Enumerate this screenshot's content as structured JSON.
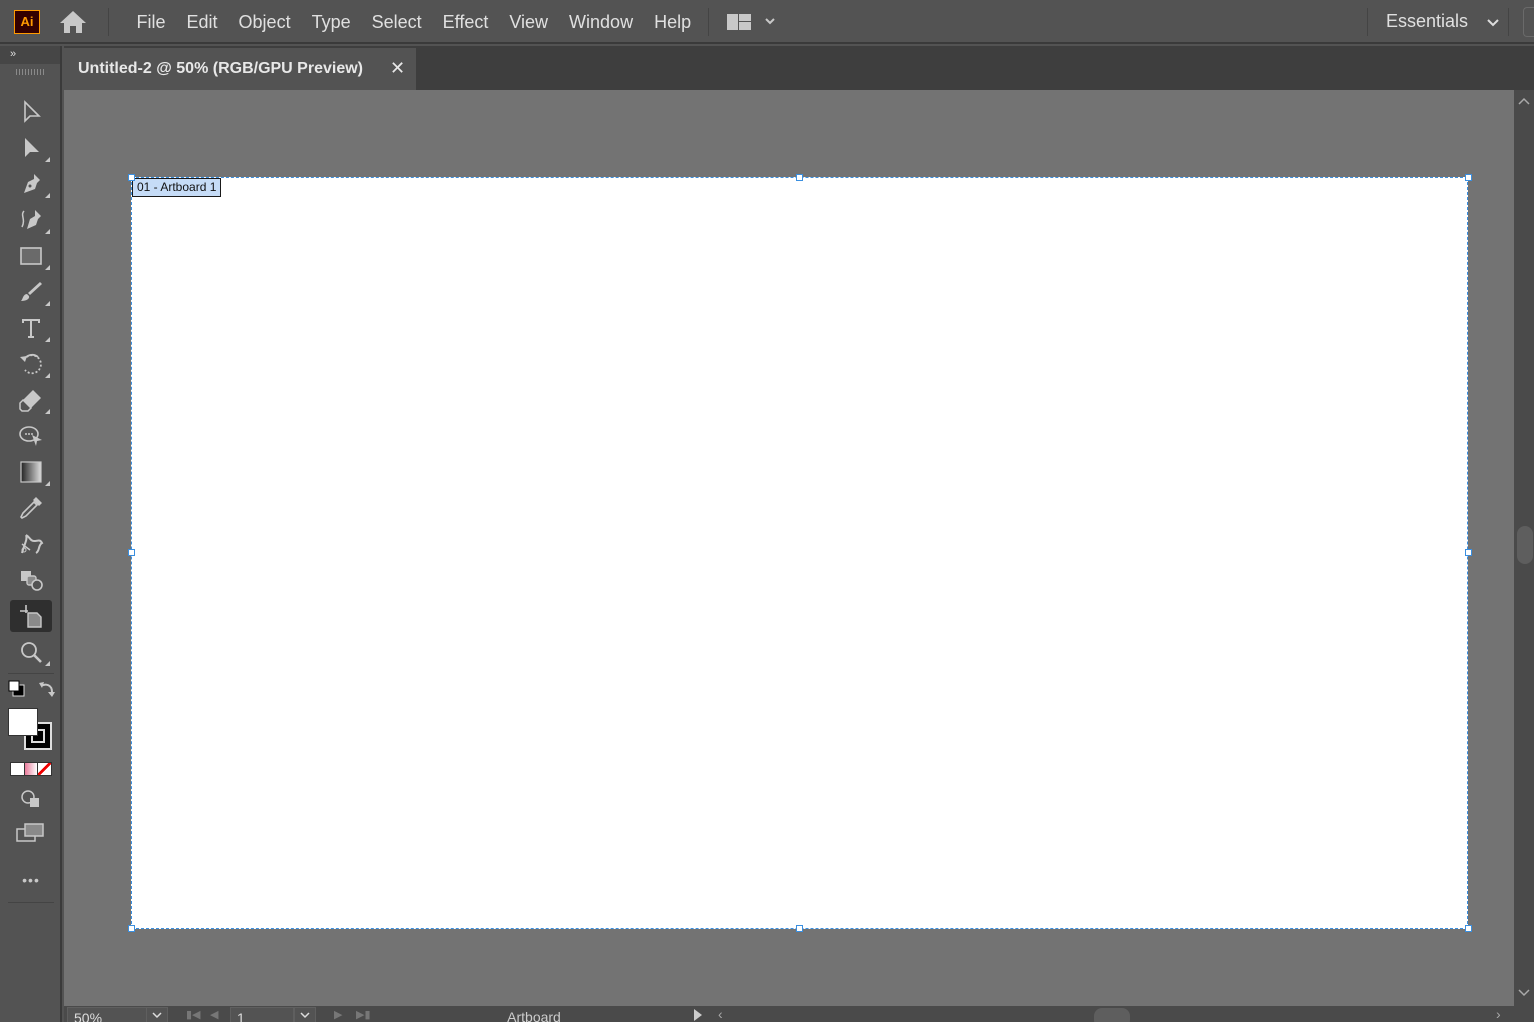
{
  "app": {
    "logo_text": "Ai",
    "brand_color": "#ff9a00"
  },
  "menubar": {
    "items": [
      "File",
      "Edit",
      "Object",
      "Type",
      "Select",
      "Effect",
      "View",
      "Window",
      "Help"
    ],
    "workspace_label": "Essentials",
    "home_icon": "home-icon",
    "arrange_icon": "arrange-documents-icon"
  },
  "toolbar": {
    "collapse_label": "»",
    "tools": [
      {
        "name": "selection-tool",
        "icon": "selection-arrow-icon",
        "has_flyout": false
      },
      {
        "name": "direct-selection-tool",
        "icon": "direct-selection-arrow-icon",
        "has_flyout": true
      },
      {
        "name": "pen-tool",
        "icon": "pen-icon",
        "has_flyout": true
      },
      {
        "name": "curvature-tool",
        "icon": "curvature-pen-icon",
        "has_flyout": true
      },
      {
        "name": "rectangle-tool",
        "icon": "rectangle-icon",
        "has_flyout": true
      },
      {
        "name": "paintbrush-tool",
        "icon": "paintbrush-icon",
        "has_flyout": true
      },
      {
        "name": "type-tool",
        "icon": "type-icon",
        "has_flyout": true
      },
      {
        "name": "rotate-tool",
        "icon": "rotate-icon",
        "has_flyout": true
      },
      {
        "name": "eraser-tool",
        "icon": "eraser-icon",
        "has_flyout": true
      },
      {
        "name": "puppet-warp-tool",
        "icon": "puppet-warp-icon",
        "has_flyout": false
      },
      {
        "name": "gradient-tool",
        "icon": "gradient-icon",
        "has_flyout": true
      },
      {
        "name": "eyedropper-tool",
        "icon": "eyedropper-icon",
        "has_flyout": false
      },
      {
        "name": "blend-tool",
        "icon": "blend-icon",
        "has_flyout": false
      },
      {
        "name": "shape-builder-tool",
        "icon": "shape-builder-icon",
        "has_flyout": false
      },
      {
        "name": "artboard-tool",
        "icon": "artboard-icon",
        "has_flyout": false,
        "active": true
      },
      {
        "name": "zoom-tool",
        "icon": "zoom-icon",
        "has_flyout": true
      }
    ],
    "fill_color": "#ffffff",
    "stroke_color": "#000000",
    "color_modes": [
      "color",
      "gradient",
      "none"
    ],
    "more_label": "•••"
  },
  "document": {
    "tab_title": "Untitled-2 @ 50% (RGB/GPU Preview)",
    "close_label": "✕",
    "artboard_label": "01 - Artboard 1"
  },
  "statusbar": {
    "zoom_value": "50%",
    "page_value": "1",
    "status_text": "Artboard"
  }
}
